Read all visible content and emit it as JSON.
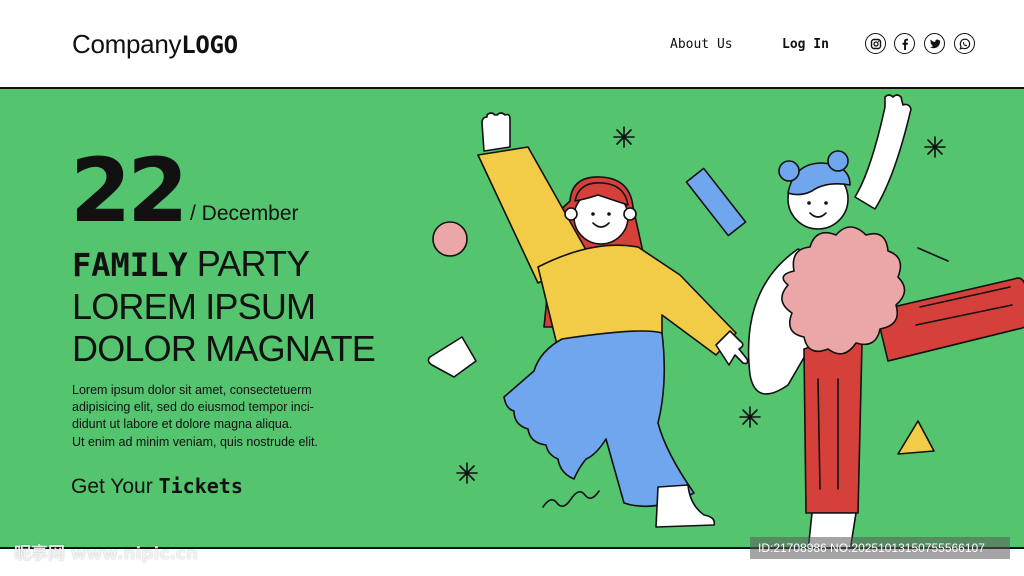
{
  "header": {
    "logo_light": "Company",
    "logo_bold": "LOGO",
    "nav": {
      "about": "About Us",
      "login": "Log In"
    },
    "social_icons": [
      "instagram-icon",
      "facebook-icon",
      "twitter-icon",
      "whatsapp-icon"
    ]
  },
  "hero": {
    "day": "22",
    "month": "/ December",
    "headline": {
      "line1_strong": "FAMILY",
      "line1_rest": " PARTY",
      "line2": "LOREM IPSUM",
      "line3": "DOLOR MAGNATE"
    },
    "description": {
      "line1": "Lorem ipsum dolor sit amet, consectetuerm",
      "line2": "adipisicing elit, sed do eiusmod tempor inci-",
      "line3": "didunt ut labore et dolore magna aliqua.",
      "line4": "Ut enim ad minim veniam, quis nostrude elit."
    },
    "cta_light": "Get Your ",
    "cta_strong": "Tickets"
  },
  "colors": {
    "background": "#54c46f",
    "outline": "#111111",
    "yellow": "#f2cc47",
    "blue": "#6fa6ee",
    "red": "#d6403a",
    "pink": "#eba7a7"
  },
  "watermark": {
    "left": "昵享网 www.nipic.cn",
    "right": "ID:21708986 NO:20251013150755566107"
  }
}
